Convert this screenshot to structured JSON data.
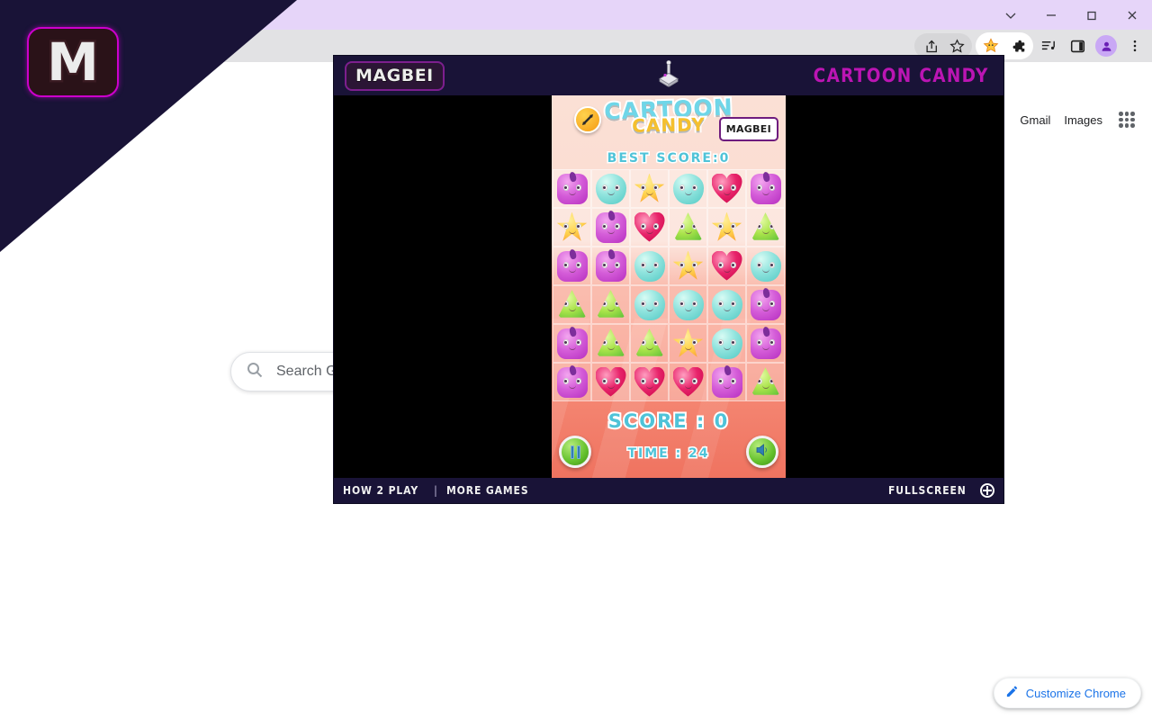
{
  "window": {
    "controls": [
      {
        "name": "tab-search-button",
        "glyph": "chevron-down-icon"
      },
      {
        "name": "minimize-button",
        "glyph": "minimize-icon"
      },
      {
        "name": "maximize-button",
        "glyph": "maximize-icon"
      },
      {
        "name": "close-button",
        "glyph": "close-icon"
      }
    ]
  },
  "toolbar": {
    "icons": [
      {
        "name": "share-icon",
        "label": "Share this page"
      },
      {
        "name": "bookmark-star-icon",
        "label": "Bookmark this tab"
      },
      {
        "name": "extension-star-icon",
        "label": "Cartoon Candy extension"
      },
      {
        "name": "extensions-puzzle-icon",
        "label": "Extensions"
      },
      {
        "name": "media-list-icon",
        "label": "Media controls"
      },
      {
        "name": "side-panel-icon",
        "label": "Side panel"
      },
      {
        "name": "profile-avatar-icon",
        "label": "Profile"
      },
      {
        "name": "chrome-menu-icon",
        "label": "Customize and control Google Chrome"
      }
    ]
  },
  "newtab": {
    "links": [
      {
        "label": "Gmail"
      },
      {
        "label": "Images"
      }
    ],
    "apps_label": "Google apps",
    "search_placeholder": "Search Google or type a URL",
    "customize_label": "Customize Chrome"
  },
  "brand": {
    "logo_letter": "M",
    "logo_border_color": "#cc00cc",
    "triangle_color": "#191337"
  },
  "game": {
    "topbar": {
      "publisher": "MAGBEI",
      "title": "CARTOON CANDY",
      "title_color": "#bb15b3",
      "joystick_icon": "joystick-icon"
    },
    "stage": {
      "refresh_icon": "refresh-arrows-icon",
      "logo_line1": "CARTOON",
      "logo_line2": "CANDY",
      "mini_badge": "MAGBEI",
      "best_score": "BEST SCORE:0",
      "score": "SCORE : 0",
      "time": "TIME : 24",
      "pause_icon": "pause-icon",
      "sound_icon": "sound-on-icon"
    },
    "bottombar": {
      "how_to_play": "HOW 2 PLAY",
      "separator": "|",
      "more_games": "MORE GAMES",
      "fullscreen": "FULLSCREEN",
      "fullscreen_icon": "fullscreen-icon"
    },
    "board": {
      "rows": 6,
      "cols": 6,
      "cells": [
        [
          {
            "c": "purple",
            "s": "sq",
            "tuft": true
          },
          {
            "c": "teal",
            "s": "cl"
          },
          {
            "c": "star",
            "s": "str"
          },
          {
            "c": "teal",
            "s": "cl"
          },
          {
            "c": "red",
            "s": "hrt"
          },
          {
            "c": "purple",
            "s": "sq",
            "tuft": true
          }
        ],
        [
          {
            "c": "star",
            "s": "str"
          },
          {
            "c": "purple",
            "s": "sq",
            "tuft": true
          },
          {
            "c": "red",
            "s": "hrt"
          },
          {
            "c": "green",
            "s": "tri"
          },
          {
            "c": "star",
            "s": "str"
          },
          {
            "c": "green",
            "s": "tri"
          }
        ],
        [
          {
            "c": "purple",
            "s": "sq",
            "tuft": true
          },
          {
            "c": "purple",
            "s": "sq",
            "tuft": true
          },
          {
            "c": "teal",
            "s": "cl"
          },
          {
            "c": "star",
            "s": "str"
          },
          {
            "c": "red",
            "s": "hrt"
          },
          {
            "c": "teal",
            "s": "cl"
          }
        ],
        [
          {
            "c": "green",
            "s": "tri"
          },
          {
            "c": "green",
            "s": "tri"
          },
          {
            "c": "teal",
            "s": "cl"
          },
          {
            "c": "teal",
            "s": "cl"
          },
          {
            "c": "teal",
            "s": "cl"
          },
          {
            "c": "purple",
            "s": "sq",
            "tuft": true
          }
        ],
        [
          {
            "c": "purple",
            "s": "sq",
            "tuft": true
          },
          {
            "c": "green",
            "s": "tri"
          },
          {
            "c": "green",
            "s": "tri"
          },
          {
            "c": "star",
            "s": "str"
          },
          {
            "c": "teal",
            "s": "cl"
          },
          {
            "c": "purple",
            "s": "sq",
            "tuft": true
          }
        ],
        [
          {
            "c": "purple",
            "s": "sq",
            "tuft": true
          },
          {
            "c": "red",
            "s": "hrt"
          },
          {
            "c": "red",
            "s": "hrt"
          },
          {
            "c": "red",
            "s": "hrt"
          },
          {
            "c": "purple",
            "s": "sq",
            "tuft": true
          },
          {
            "c": "green",
            "s": "tri"
          }
        ]
      ]
    }
  }
}
